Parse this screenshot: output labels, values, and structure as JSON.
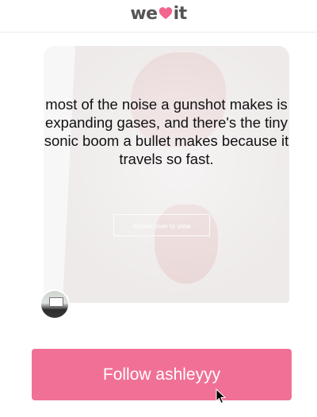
{
  "header": {
    "logo_left": "we",
    "logo_right": "it",
    "logo_heart_color": "#f1668f"
  },
  "card": {
    "quote": "most of the noise a gunshot makes is expanding gases, and there's the tiny sonic boom a bullet makes because it travels so fast.",
    "mouse_over_label": "mouse over to view"
  },
  "follow_button": {
    "label": "Follow ashleyyy",
    "color": "#f07096"
  }
}
